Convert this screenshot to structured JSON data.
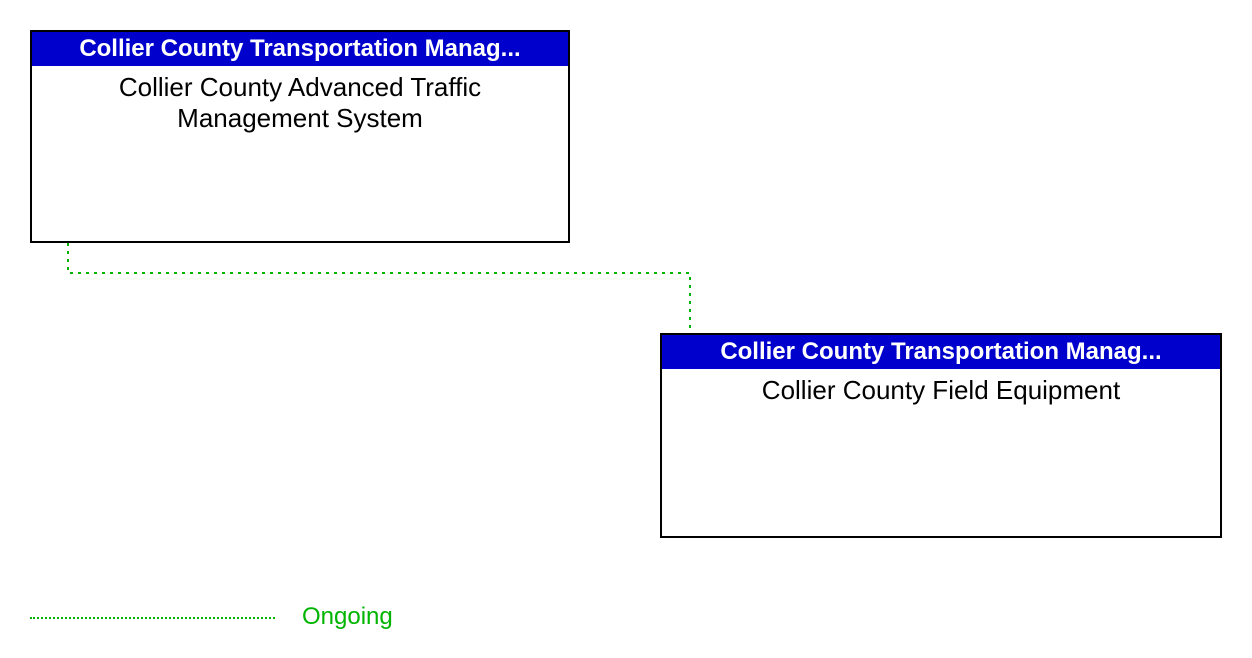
{
  "nodes": {
    "top": {
      "header": "Collier County Transportation Manag...",
      "body": "Collier County Advanced Traffic Management System"
    },
    "bottom": {
      "header": "Collier County Transportation Manag...",
      "body": "Collier County Field Equipment"
    }
  },
  "legend": {
    "label": "Ongoing"
  },
  "colors": {
    "header_bg": "#0000cd",
    "header_text": "#ffffff",
    "line": "#00b400"
  }
}
